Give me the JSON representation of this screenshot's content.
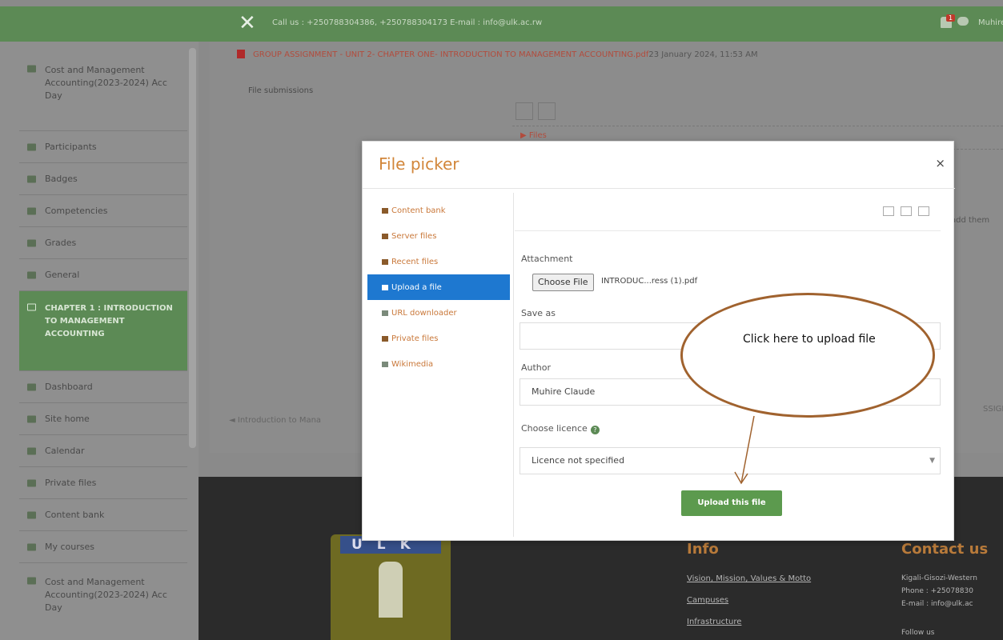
{
  "topbar": {
    "contact_text": "Call us : +250788304386, +250788304173 E-mail : info@ulk.ac.rw",
    "notification_count": "1",
    "user_name": "Muhire C"
  },
  "sidebar": {
    "items": [
      {
        "label": "Cost and Management Accounting(2023-2024) Acc Day"
      },
      {
        "label": "Participants"
      },
      {
        "label": "Badges"
      },
      {
        "label": "Competencies"
      },
      {
        "label": "Grades"
      },
      {
        "label": "General"
      },
      {
        "label": "CHAPTER 1 : INTRODUCTION TO MANAGEMENT ACCOUNTING"
      },
      {
        "label": "Dashboard"
      },
      {
        "label": "Site home"
      },
      {
        "label": "Calendar"
      },
      {
        "label": "Private files"
      },
      {
        "label": "Content bank"
      },
      {
        "label": "My courses"
      },
      {
        "label": "Cost and Management Accounting(2023-2024) Acc Day"
      }
    ]
  },
  "main": {
    "assignment_file": "GROUP ASSIGNMENT - UNIT 2- CHAPTER ONE- INTRODUCTION TO MANAGEMENT ACCOUNTING.pdf",
    "assignment_date": "23 January 2024, 11:53 AM",
    "file_submissions_label": "File submissions",
    "files_label": "Files",
    "add_them_text": "add them",
    "prev_link": "◄ Introduction to Mana",
    "next_link": "SSIGNMEN"
  },
  "footer": {
    "logo_letters": "ULK",
    "info_heading": "Info",
    "info_links": [
      "Vision, Mission, Values & Motto",
      "Campuses",
      "Infrastructure"
    ],
    "contact_heading": "Contact us",
    "contact_lines": [
      "Kigali-Gisozi-Western",
      "Phone : +25078830",
      "E-mail : info@ulk.ac",
      "Follow us"
    ]
  },
  "modal": {
    "title": "File picker",
    "close": "×",
    "repositories": [
      {
        "label": "Content bank"
      },
      {
        "label": "Server files"
      },
      {
        "label": "Recent files"
      },
      {
        "label": "Upload a file"
      },
      {
        "label": "URL downloader"
      },
      {
        "label": "Private files"
      },
      {
        "label": "Wikimedia"
      }
    ],
    "attachment_label": "Attachment",
    "choose_file_label": "Choose File",
    "chosen_file_name": "INTRODUC...ress (1).pdf",
    "save_as_label": "Save as",
    "save_as_value": "",
    "author_label": "Author",
    "author_value": "Muhire Claude",
    "licence_label": "Choose licence",
    "licence_value": "Licence not specified",
    "upload_button": "Upload this file"
  },
  "annotation": {
    "text": "Click here to upload file",
    "color": "#a0622e"
  }
}
